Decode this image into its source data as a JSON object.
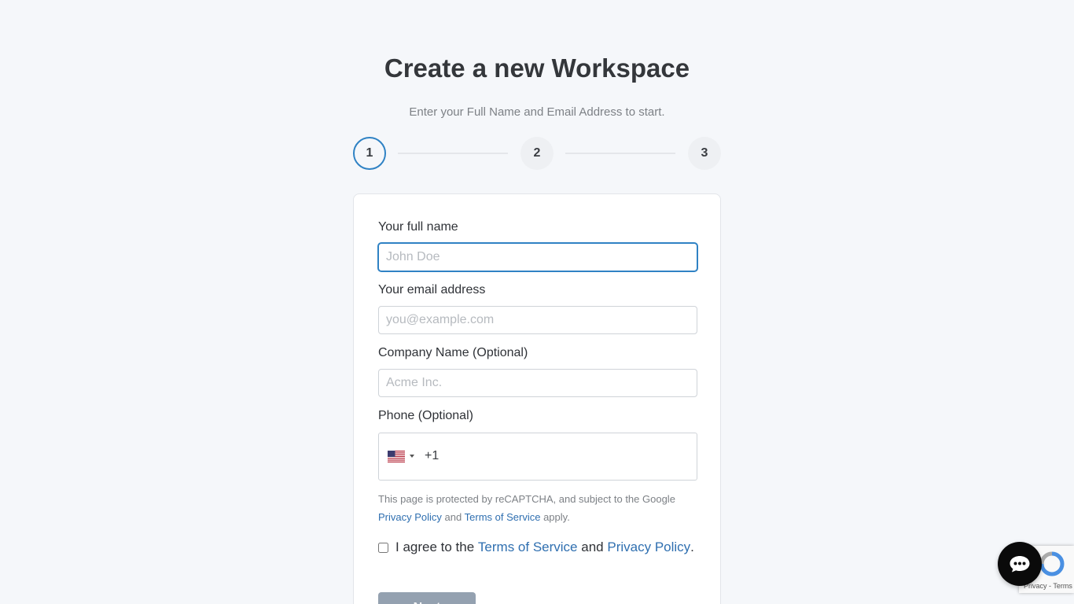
{
  "page": {
    "title": "Create a new Workspace",
    "subtitle": "Enter your Full Name and Email Address to start."
  },
  "stepper": {
    "steps": [
      "1",
      "2",
      "3"
    ],
    "active_step": 1
  },
  "form": {
    "full_name": {
      "label": "Your full name",
      "placeholder": "John Doe"
    },
    "email": {
      "label": "Your email address",
      "placeholder": "you@example.com"
    },
    "company": {
      "label": "Company Name (Optional)",
      "placeholder": "Acme Inc."
    },
    "phone": {
      "label": "Phone (Optional)",
      "country_icon": "us-flag-icon",
      "dial_code": "+1"
    }
  },
  "recaptcha_note": {
    "prefix": "This page is protected by reCAPTCHA, and subject to the Google",
    "privacy_link": "Privacy Policy",
    "and": "and",
    "terms_link": "Terms of Service",
    "suffix": "apply."
  },
  "agreement": {
    "prefix": "I agree to the",
    "terms_link": "Terms of Service",
    "and": "and",
    "privacy_link": "Privacy Policy",
    "suffix": "."
  },
  "next_button": {
    "label": "Next"
  },
  "recaptcha_badge": {
    "text": "Privacy - Terms"
  },
  "colors": {
    "accent": "#2f82c4",
    "link": "#2f6fb0",
    "background": "#f5f7fa",
    "button_disabled": "#94a1b0"
  }
}
